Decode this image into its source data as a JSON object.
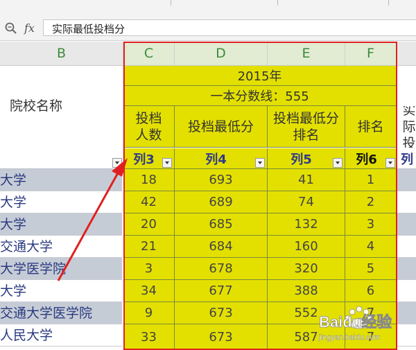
{
  "formula_bar": {
    "fx_label": "fx",
    "content": "实际最低投档分"
  },
  "columns": [
    "B",
    "C",
    "D",
    "E",
    "F"
  ],
  "table": {
    "year_title": "2015年",
    "cutoff_line": "一本分数线：555",
    "headers": {
      "b": "院校名称",
      "c": "投档人数",
      "d": "投档最低分",
      "e": "投档最低分排名",
      "f": "排名",
      "g_partial": "实际投"
    },
    "filter_labels": {
      "c": "列3",
      "d": "列4",
      "e": "列5",
      "f": "列6",
      "g_partial": "列"
    },
    "rows": [
      {
        "name": "大学",
        "c": "18",
        "d": "693",
        "e": "41",
        "f": "1"
      },
      {
        "name": "大学",
        "c": "42",
        "d": "689",
        "e": "74",
        "f": "2"
      },
      {
        "name": "大学",
        "c": "20",
        "d": "685",
        "e": "132",
        "f": "3"
      },
      {
        "name": "交通大学",
        "c": "21",
        "d": "684",
        "e": "160",
        "f": "4"
      },
      {
        "name": "大学医学院",
        "c": "3",
        "d": "678",
        "e": "320",
        "f": "5"
      },
      {
        "name": "大学",
        "c": "34",
        "d": "677",
        "e": "388",
        "f": "6"
      },
      {
        "name": "交通大学医学院",
        "c": "9",
        "d": "673",
        "e": "552",
        "f": "7"
      },
      {
        "name": "人民大学",
        "c": "33",
        "d": "673",
        "e": "587",
        "f": "7"
      }
    ]
  },
  "watermark": {
    "brand": "Baidu经验",
    "url": "jingyan.baidu.com"
  },
  "colors": {
    "highlight": "#e3e000",
    "selection_border": "#e02020",
    "arrow": "#e02020",
    "row_band": "#c6ccd6"
  }
}
